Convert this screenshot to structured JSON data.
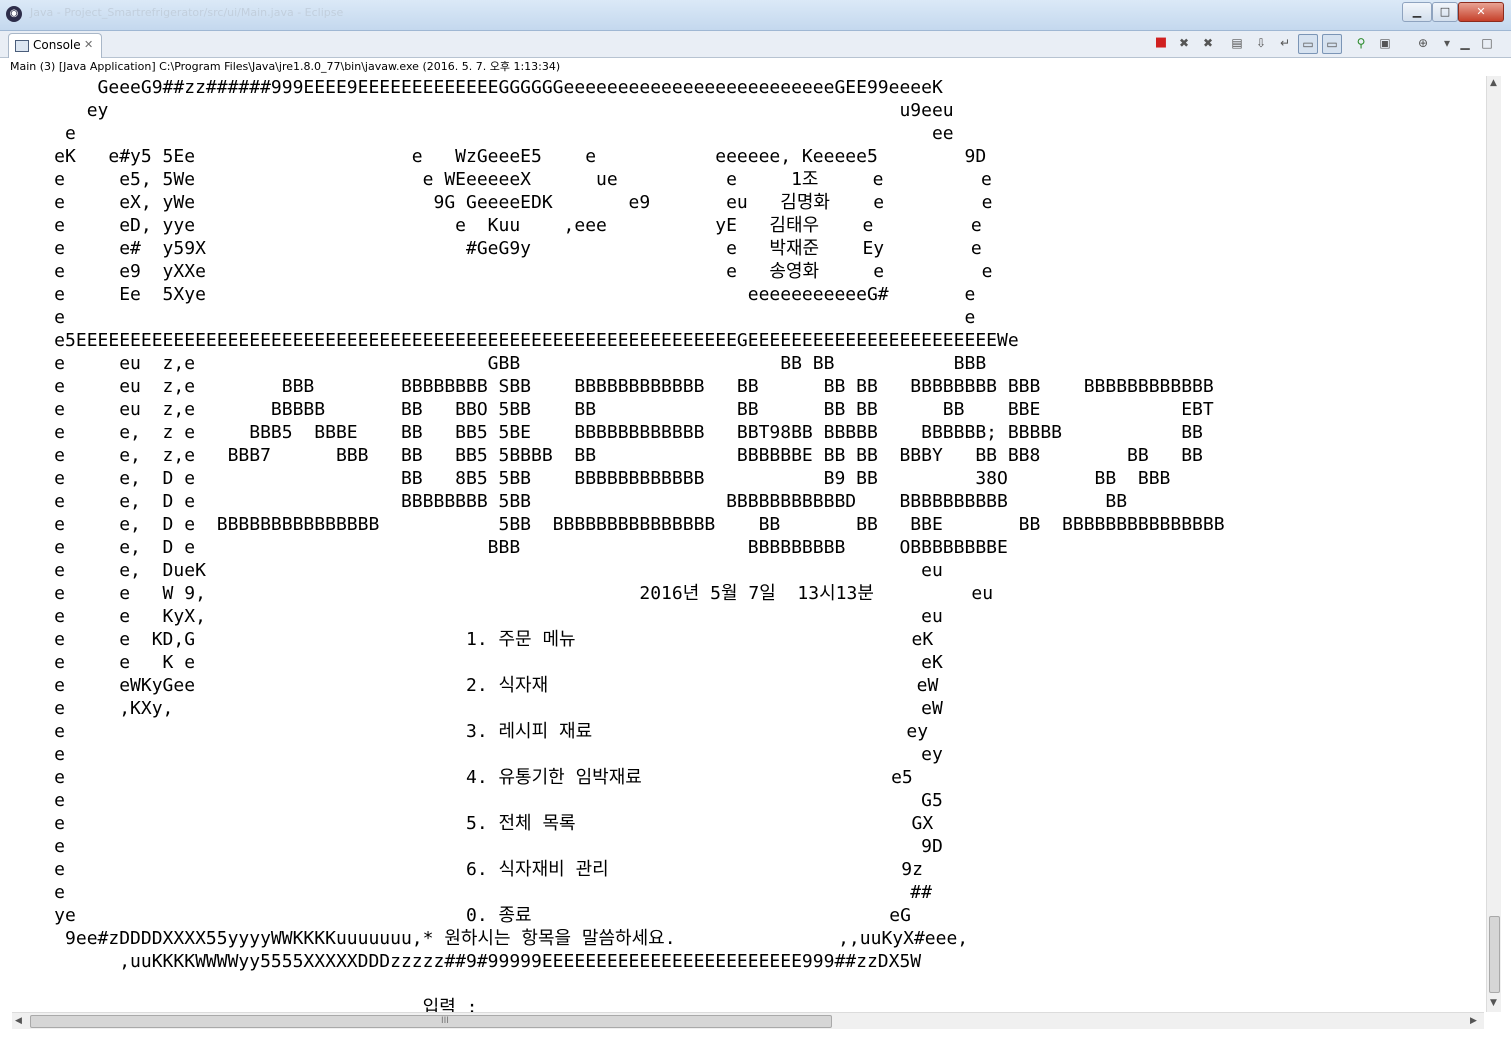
{
  "window": {
    "title": "Java - Project_Smartrefrigerator/src/ui/Main.java - Eclipse",
    "minimize_glyph": "▁",
    "maximize_glyph": "□",
    "close_glyph": "✕"
  },
  "tab": {
    "label": "Console",
    "close_glyph": "✕"
  },
  "toolbar": {
    "icons": [
      {
        "name": "terminate-icon",
        "glyph": "■"
      },
      {
        "name": "remove-launch-icon",
        "glyph": "✖"
      },
      {
        "name": "remove-all-terminated-icon",
        "glyph": "✖"
      },
      {
        "name": "clear-console-icon",
        "glyph": "▤"
      },
      {
        "name": "scroll-lock-icon",
        "glyph": "⇩"
      },
      {
        "name": "word-wrap-icon",
        "glyph": "↵"
      },
      {
        "name": "show-on-stdout-icon",
        "glyph": "▭"
      },
      {
        "name": "show-on-stderr-icon",
        "glyph": "▭"
      },
      {
        "name": "pin-console-icon",
        "glyph": "⚲"
      },
      {
        "name": "display-console-icon",
        "glyph": "▣"
      },
      {
        "name": "open-console-icon",
        "glyph": "⊕"
      },
      {
        "name": "view-menu-icon",
        "glyph": "▾"
      },
      {
        "name": "minimize-view-icon",
        "glyph": "▁"
      },
      {
        "name": "maximize-view-icon",
        "glyph": "□"
      }
    ]
  },
  "process_line": "Main (3) [Java Application] C:\\Program Files\\Java\\jre1.8.0_77\\bin\\javaw.exe (2016. 5. 7. 오후 1:13:34)",
  "console_lines": [
    "         GeeeG9##zz######999EEEE9EEEEEEEEEEEEEGGGGGGeeeeeeeeeeeeeeeeeeeeeeeeeGEE99eeeeK",
    "        ey                                                                         u9eeu",
    "      e                                                                               ee",
    "     eK   e#y5 5Ee                    e   WzGeeeE5    e           eeeeee, Keeeee5        9D",
    "     e     e5, 5We                     e WEeeeeeX      ue          e     1조     e         e",
    "     e     eX, yWe                      9G GeeeeEDK       e9       eu   김명화    e         e",
    "     e     eD, yye                        e  Kuu    ,eee          yE   김태우    e         e",
    "     e     e#  y59X                        #GeG9y                  e   박재준    Ey        e",
    "     e     e9  yXXe                                                e   송영화     e         e",
    "     e     Ee  5Xye                                                  eeeeeeeeeeeG#       e",
    "     e                                                                                   e",
    "     e5EEEEEEEEEEEEEEEEEEEEEEEEEEEEEEEEEEEEEEEEEEEEEEEEEEEEEEEEEEEEEGEEEEEEEEEEEEEEEEEEEEEEEWe",
    "     e     eu  z,e                           GBB                        BB BB           BBB",
    "     e     eu  z,e        BBB        BBBBBBBB SBB    BBBBBBBBBBBB   BB      BB BB   BBBBBBBB BBB    BBBBBBBBBBBB",
    "     e     eu  z,e       BBBBB       BB   BBO 5BB    BB             BB      BB BB      BB    BBE             EBT",
    "     e     e,  z e     BBB5  BBBE    BB   BB5 5BE    BBBBBBBBBBBB   BBT98BB BBBBB    BBBBBB; BBBBB           BB",
    "     e     e,  z,e   BBB7      BBB   BB   BB5 5BBBB  BB             BBBBBBE BB BB  BBBY   BB BB8        BB   BB",
    "     e     e,  D e                   BB   8B5 5BB    BBBBBBBBBBBB           B9 BB         38O        BB  BBB",
    "     e     e,  D e                   BBBBBBBB 5BB                  BBBBBBBBBBBD    BBBBBBBBBB         BB",
    "     e     e,  D e  BBBBBBBBBBBBBBB           5BB  BBBBBBBBBBBBBBB    BB       BB   BBE       BB  BBBBBBBBBBBBBBB",
    "     e     e,  D e                           BBB                     BBBBBBBBB     OBBBBBBBBE",
    "     e     e,  DueK                                                                  eu",
    "     e     e   W 9,                                        2016년 5월 7일  13시13분         eu",
    "     e     e   KyX,                                                                  eu",
    "     e     e  KD,G                         1. 주문 메뉴                               eK",
    "     e     e   K e                                                                   eK",
    "     e     eWKyGee                         2. 식자재                                  eW",
    "     e     ,KXy,                                                                     eW",
    "     e                                     3. 레시피 재료                             ey",
    "     e                                                                               ey",
    "     e                                     4. 유통기한 임박재료                       e5",
    "     e                                                                               G5",
    "     e                                     5. 전체 목록                               GX",
    "     e                                                                               9D",
    "     e                                     6. 식자재비 관리                           9z",
    "     e                                                                              ##",
    "     ye                                    0. 종료                                 eG",
    "      9ee#zDDDDXXXX55yyyyWWKKKKuuuuuuu,* 원하시는 항목을 말씀하세요.               ,,uuKyX#eee,",
    "           ,uuKKKKWWWWyy5555XXXXXDDDzzzzz##9#99999EEEEEEEEEEEEEEEEEEEEEEEE999##zzDX5W",
    "",
    "                                       입력 :"
  ],
  "scrollbar": {
    "up_arrow": "▲",
    "down_arrow": "▼",
    "left_arrow": "◀",
    "right_arrow": "▶",
    "grip": "III"
  }
}
